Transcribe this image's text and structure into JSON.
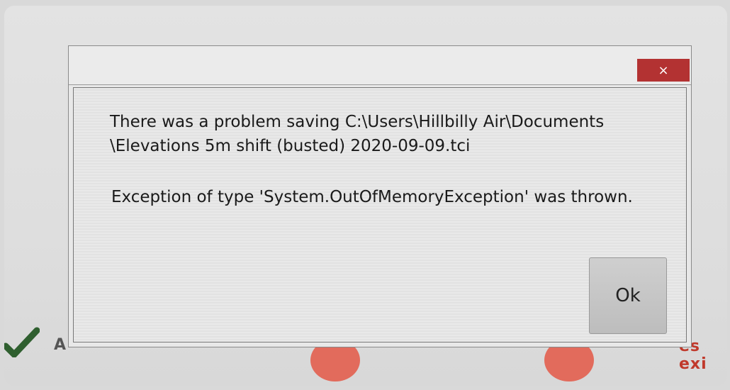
{
  "background": {
    "partial_left_text": "A",
    "partial_right_text": "es exi",
    "check_icon": "checkmark-icon",
    "accent_colors": {
      "check": "#2f5f2f",
      "red": "#e26b5c"
    }
  },
  "dialog": {
    "close_icon": "close-icon",
    "close_label": "×",
    "message_line1": "There was a problem saving C:\\Users\\Hillbilly Air\\Documents",
    "message_line2": "\\Elevations 5m shift (busted) 2020-09-09.tci",
    "exception_text": "Exception of type 'System.OutOfMemoryException' was thrown.",
    "ok_label": "Ok",
    "colors": {
      "close_button": "#b33232"
    }
  }
}
